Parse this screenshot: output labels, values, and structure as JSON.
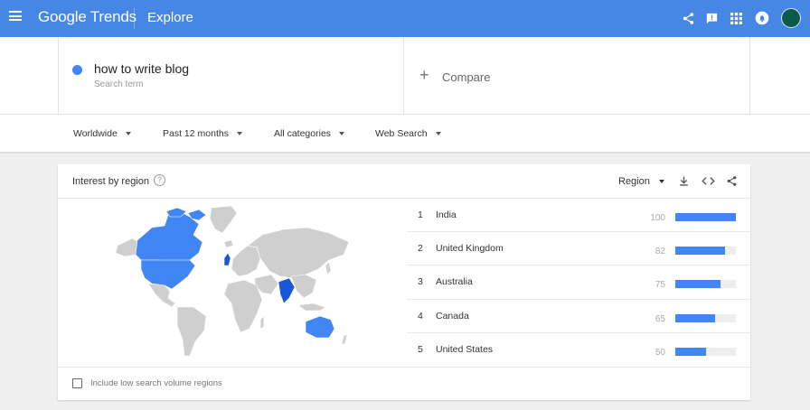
{
  "header": {
    "logo_text": "Google Trends",
    "page_title": "Explore",
    "colors": {
      "bar": "#4687e6",
      "avatar": "#0b5a4a"
    },
    "icons": [
      "menu-icon",
      "share-icon",
      "feedback-icon",
      "apps-icon",
      "notifications-icon",
      "avatar"
    ]
  },
  "search": {
    "term": "how to write blog",
    "term_sub": "Search term",
    "term_color": "#4285f4",
    "compare_plus": "+",
    "compare_label": "Compare"
  },
  "filters": {
    "location": "Worldwide",
    "time": "Past 12 months",
    "category": "All categories",
    "property": "Web Search"
  },
  "card": {
    "title": "Interest by region",
    "help": "?",
    "region_select": "Region",
    "icons": [
      "download-icon",
      "embed-icon",
      "share-icon"
    ],
    "footer_checkbox_label": "Include low search volume regions"
  },
  "regions": [
    {
      "rank": "1",
      "name": "India",
      "value": 100
    },
    {
      "rank": "2",
      "name": "United Kingdom",
      "value": 82
    },
    {
      "rank": "3",
      "name": "Australia",
      "value": 75
    },
    {
      "rank": "4",
      "name": "Canada",
      "value": 65
    },
    {
      "rank": "5",
      "name": "United States",
      "value": 50
    }
  ],
  "map": {
    "highlighted_regions": [
      "India",
      "United Kingdom",
      "Australia",
      "Canada",
      "United States"
    ],
    "colors": {
      "land": "#cfcfcf",
      "highlight": "#4285f4",
      "strong": "#1a57d8"
    }
  }
}
